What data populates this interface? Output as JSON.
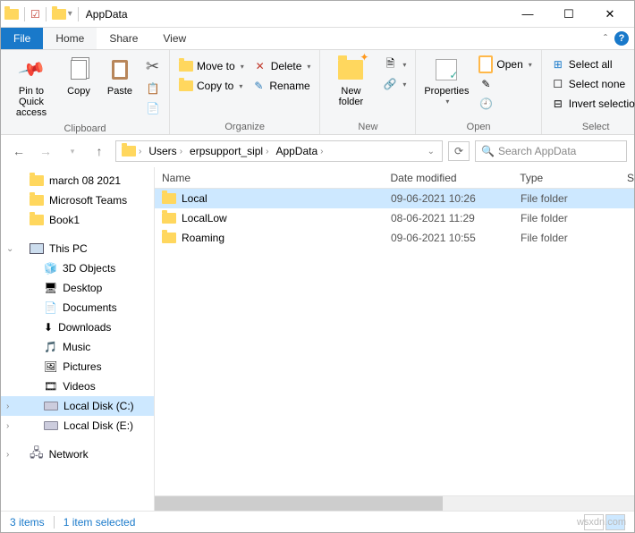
{
  "window": {
    "title": "AppData"
  },
  "tabs": {
    "file": "File",
    "home": "Home",
    "share": "Share",
    "view": "View"
  },
  "ribbon": {
    "clipboard": {
      "label": "Clipboard",
      "pin": "Pin to Quick access",
      "copy": "Copy",
      "paste": "Paste"
    },
    "organize": {
      "label": "Organize",
      "moveto": "Move to",
      "copyto": "Copy to",
      "delete": "Delete",
      "rename": "Rename"
    },
    "new": {
      "label": "New",
      "newfolder": "New folder"
    },
    "open": {
      "label": "Open",
      "properties": "Properties",
      "open": "Open"
    },
    "select": {
      "label": "Select",
      "all": "Select all",
      "none": "Select none",
      "invert": "Invert selection"
    }
  },
  "breadcrumb": {
    "items": [
      "Users",
      "erpsupport_sipl",
      "AppData"
    ]
  },
  "search": {
    "placeholder": "Search AppData"
  },
  "navpane": {
    "quick": [
      "march 08 2021",
      "Microsoft Teams",
      "Book1"
    ],
    "thispc": "This PC",
    "pcitems": [
      "3D Objects",
      "Desktop",
      "Documents",
      "Downloads",
      "Music",
      "Pictures",
      "Videos",
      "Local Disk (C:)",
      "Local Disk (E:)"
    ],
    "network": "Network",
    "selected": "Local Disk (C:)"
  },
  "columns": {
    "name": "Name",
    "date": "Date modified",
    "type": "Type",
    "size": "S"
  },
  "files": [
    {
      "name": "Local",
      "date": "09-06-2021 10:26",
      "type": "File folder",
      "selected": true
    },
    {
      "name": "LocalLow",
      "date": "08-06-2021 11:29",
      "type": "File folder",
      "selected": false
    },
    {
      "name": "Roaming",
      "date": "09-06-2021 10:55",
      "type": "File folder",
      "selected": false
    }
  ],
  "status": {
    "count": "3 items",
    "selected": "1 item selected"
  },
  "watermark": "wsxdn.com"
}
